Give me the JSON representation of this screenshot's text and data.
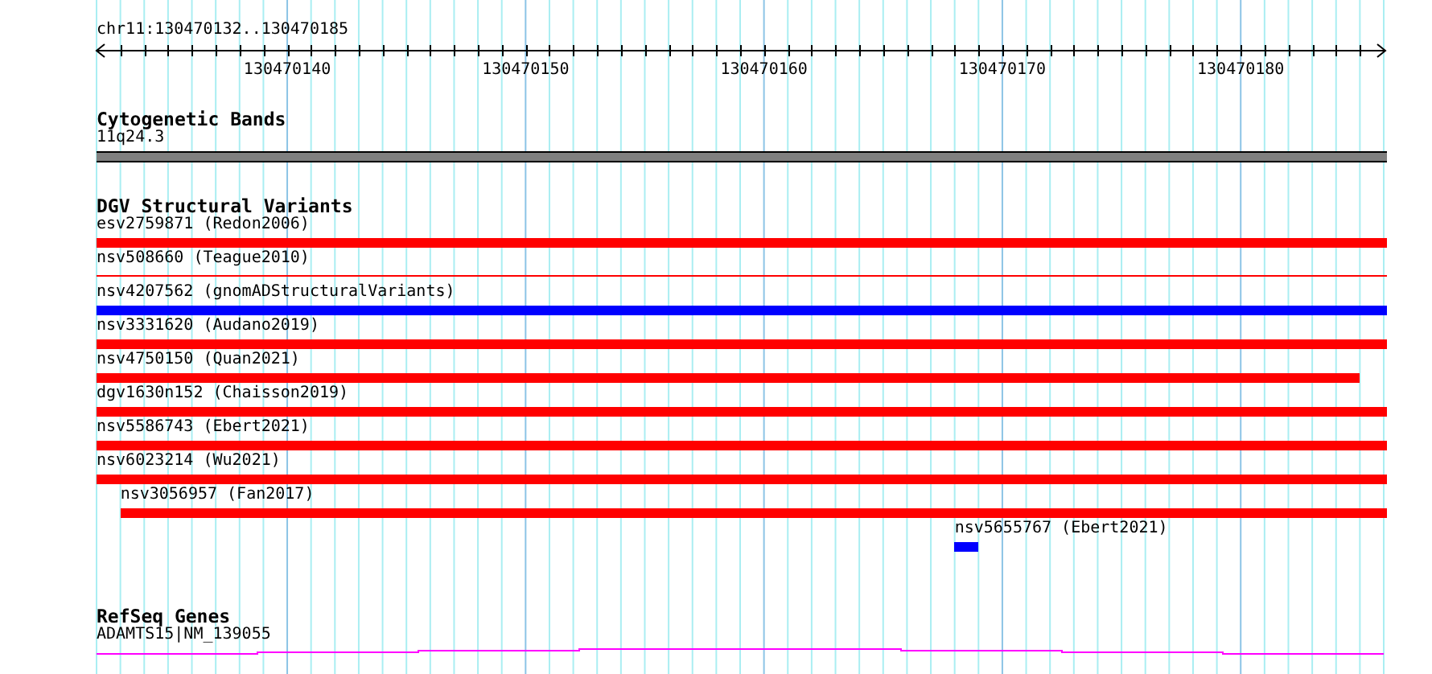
{
  "ruler": {
    "title": "chr11:130470132..130470185",
    "labels": [
      "130470140",
      "130470150",
      "130470160",
      "130470170",
      "130470180"
    ]
  },
  "tracks": [
    {
      "kind": "band",
      "title": "Cytogenetic Bands",
      "label": "11q24.3"
    },
    {
      "kind": "variants",
      "title": "DGV Structural Variants",
      "features": [
        {
          "label": "esv2759871 (Redon2006)",
          "color": "#ff0000",
          "kind": "full"
        },
        {
          "label": "nsv508660 (Teague2010)",
          "color": "#ff0000",
          "kind": "thin"
        },
        {
          "label": "nsv4207562 (gnomADStructuralVariants)",
          "color": "#0000ff",
          "kind": "full"
        },
        {
          "label": "nsv3331620 (Audano2019)",
          "color": "#ff0000",
          "kind": "full"
        },
        {
          "label": "nsv4750150 (Quan2021)",
          "color": "#ff0000",
          "kind": "clipped"
        },
        {
          "label": "dgv1630n152 (Chaisson2019)",
          "color": "#ff0000",
          "kind": "full"
        },
        {
          "label": "nsv5586743 (Ebert2021)",
          "color": "#ff0000",
          "kind": "full"
        },
        {
          "label": "nsv6023214 (Wu2021)",
          "color": "#ff0000",
          "kind": "full"
        },
        {
          "label": "nsv3056957 (Fan2017)",
          "color": "#ff0000",
          "kind": "inset"
        },
        {
          "label": "nsv5655767 (Ebert2021)",
          "color": "#0000ff",
          "kind": "point"
        }
      ]
    },
    {
      "kind": "gene",
      "title": "RefSeq Genes",
      "label": "ADAMTS15|NM_139055"
    }
  ]
}
